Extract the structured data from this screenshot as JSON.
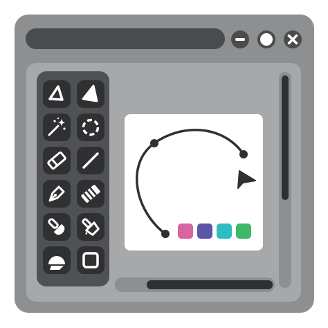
{
  "colors": {
    "window_frame": "#8e8f90",
    "titlebar": "#4a4b4d",
    "workspace": "#a7a8a9",
    "toolbox": "#505154",
    "tool_bg": "#2f3032",
    "tool_icon": "#ffffff",
    "scroll_track": "#8e8f90",
    "scroll_thumb": "#2f3032",
    "canvas": "#ffffff",
    "stroke": "#2f3032"
  },
  "window_controls": {
    "minimize_icon": "minus-icon",
    "maximize_icon": "circle-icon",
    "close_icon": "x-icon"
  },
  "tools": [
    {
      "icon": "lasso-outline-icon"
    },
    {
      "icon": "lasso-filled-icon"
    },
    {
      "icon": "magic-wand-icon"
    },
    {
      "icon": "ellipse-select-icon"
    },
    {
      "icon": "eraser-icon"
    },
    {
      "icon": "line-icon"
    },
    {
      "icon": "pen-nib-icon"
    },
    {
      "icon": "pattern-eraser-icon"
    },
    {
      "icon": "smudge-brush-icon"
    },
    {
      "icon": "fill-bucket-icon"
    },
    {
      "icon": "shape-fill-icon"
    },
    {
      "icon": "rectangle-icon"
    }
  ],
  "canvas": {
    "shape": "bezier-curve-arc",
    "palette": [
      "#d865a1",
      "#5b55a8",
      "#2fbcc0",
      "#3fb86a"
    ]
  }
}
